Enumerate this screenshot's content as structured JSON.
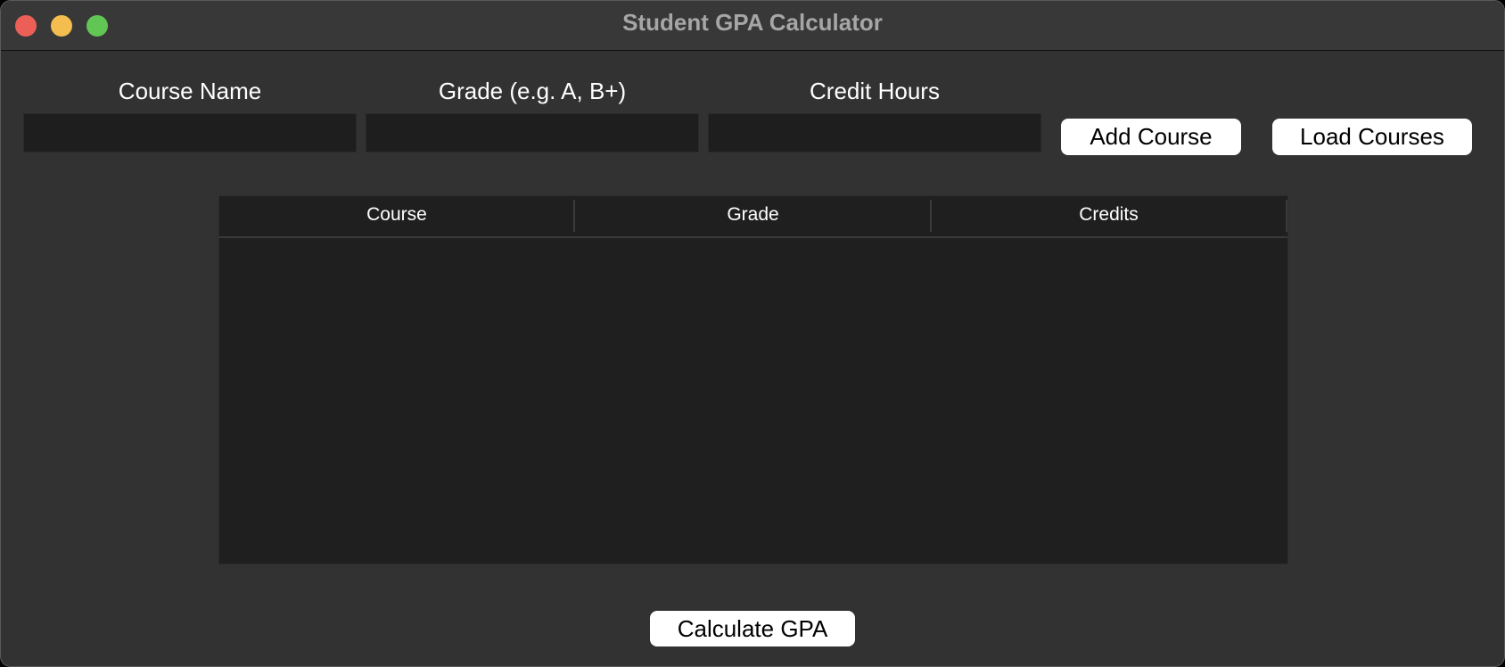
{
  "window": {
    "title": "Student GPA Calculator"
  },
  "form": {
    "course_name_label": "Course Name",
    "grade_label": "Grade (e.g. A, B+)",
    "credit_hours_label": "Credit Hours",
    "course_name_value": "",
    "grade_value": "",
    "credit_hours_value": "",
    "add_course_label": "Add Course",
    "load_courses_label": "Load Courses"
  },
  "table": {
    "columns": [
      "Course",
      "Grade",
      "Credits"
    ],
    "rows": []
  },
  "footer": {
    "calculate_label": "Calculate GPA"
  },
  "colors": {
    "window_bg": "#323232",
    "titlebar_bg": "#383838",
    "close": "#ec5f57",
    "minimize": "#f4bd4f",
    "maximize": "#62c655",
    "input_bg": "#1e1e1e",
    "table_bg": "#1f1f1f",
    "button_bg": "#ffffff"
  }
}
